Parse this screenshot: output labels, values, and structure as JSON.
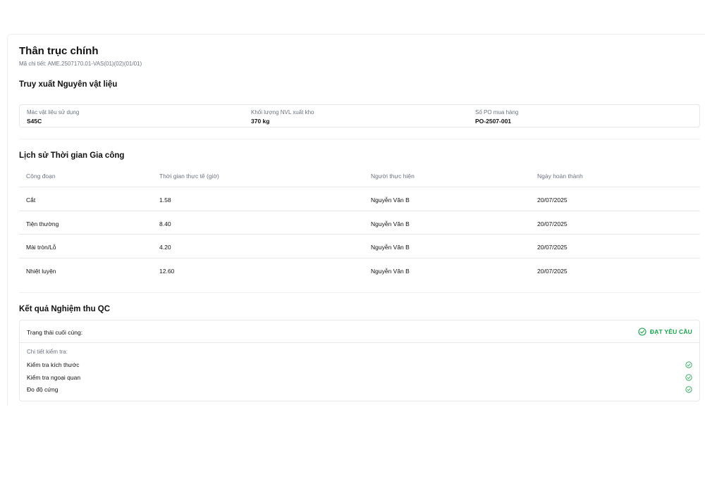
{
  "header": {
    "title": "Thân trục chính",
    "subtitle": "Mã chi tiết: AME.2507170.01-VAS(01)(02)(01/01)"
  },
  "materials": {
    "section_title": "Truy xuất Nguyên vật liệu",
    "fields": [
      {
        "label": "Mác vật liệu sử dụng",
        "value": "S45C"
      },
      {
        "label": "Khối lượng NVL xuất kho",
        "value": "370 kg"
      },
      {
        "label": "Số PO mua hàng",
        "value": "PO-2507-001"
      }
    ]
  },
  "processing": {
    "section_title": "Lịch sử Thời gian Gia công",
    "columns": [
      "Công đoạn",
      "Thời gian thực tế (giờ)",
      "Người thực hiện",
      "Ngày hoàn thành"
    ],
    "rows": [
      {
        "step": "Cắt",
        "hours": "1.58",
        "operator": "Nguyễn Văn B",
        "date": "20/07/2025"
      },
      {
        "step": "Tiện thường",
        "hours": "8.40",
        "operator": "Nguyễn Văn B",
        "date": "20/07/2025"
      },
      {
        "step": "Mài tròn/Lỗ",
        "hours": "4.20",
        "operator": "Nguyễn Văn B",
        "date": "20/07/2025"
      },
      {
        "step": "Nhiệt luyện",
        "hours": "12.60",
        "operator": "Nguyễn Văn B",
        "date": "20/07/2025"
      }
    ]
  },
  "qc": {
    "section_title": "Kết quả Nghiệm thu QC",
    "status_label": "Trạng thái cuối cùng:",
    "status_value": "ĐẠT YÊU CẦU",
    "status_color": "#16a34a",
    "status_icon": "check-circle-icon",
    "detail_label": "Chi tiết kiểm tra:",
    "checks": [
      {
        "label": "Kiểm tra kích thước",
        "icon": "check-circle-icon"
      },
      {
        "label": "Kiểm tra ngoại quan",
        "icon": "check-circle-icon"
      },
      {
        "label": "Đo độ cứng",
        "icon": "check-circle-icon"
      }
    ]
  }
}
